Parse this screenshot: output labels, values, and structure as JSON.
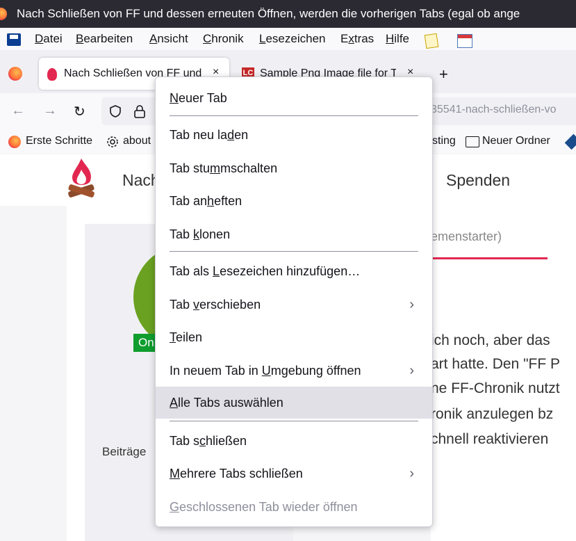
{
  "window": {
    "title": "Nach Schließen von FF und dessen erneuten Öffnen, werden die vorherigen Tabs (egal ob ange"
  },
  "menubar": {
    "items": [
      {
        "pre": "",
        "key": "D",
        "post": "atei"
      },
      {
        "pre": "",
        "key": "B",
        "post": "earbeiten"
      },
      {
        "pre": "",
        "key": "A",
        "post": "nsicht"
      },
      {
        "pre": "",
        "key": "C",
        "post": "hronik"
      },
      {
        "pre": "",
        "key": "L",
        "post": "esezeichen"
      },
      {
        "pre": "E",
        "key": "x",
        "post": "tras"
      },
      {
        "pre": "",
        "key": "H",
        "post": "ilfe"
      }
    ]
  },
  "tabs": [
    {
      "title": "Nach Schließen von FF und",
      "close": "×"
    },
    {
      "title": "Sample Png Image file for T",
      "close": "×",
      "icon_text": "LC"
    }
  ],
  "newtab": "+",
  "nav": {
    "back": "←",
    "forward": "→",
    "reload": "↻",
    "url_visible": "35541-nach-schließen-vo"
  },
  "bookmarks": [
    {
      "label": "Erste Schritte"
    },
    {
      "label": "about"
    },
    {
      "label": "sting"
    },
    {
      "label": "Neuer Ordner"
    }
  ],
  "site": {
    "nav_left": "Nach",
    "nav_right": "Spenden",
    "online_badge": "On",
    "beitraege": "Beiträge",
    "tab_label": "emenstarter)",
    "post_lines": [
      "ich noch, aber das",
      "art hatte. Den \"FF P",
      "ne FF-Chronik nutzt",
      "ronik anzulegen bz",
      "chnell reaktivieren"
    ]
  },
  "context_menu": {
    "items": [
      {
        "pre": "",
        "key": "N",
        "post": "euer Tab",
        "arrow": false,
        "highlight": false,
        "disabled": false
      },
      {
        "pre": "Tab neu la",
        "key": "d",
        "post": "en",
        "arrow": false,
        "highlight": false,
        "disabled": false
      },
      {
        "pre": "Tab stu",
        "key": "m",
        "post": "mschalten",
        "arrow": false,
        "highlight": false,
        "disabled": false
      },
      {
        "pre": "Tab an",
        "key": "h",
        "post": "eften",
        "arrow": false,
        "highlight": false,
        "disabled": false
      },
      {
        "pre": "Tab ",
        "key": "k",
        "post": "lonen",
        "arrow": false,
        "highlight": false,
        "disabled": false
      },
      {
        "pre": "Tab als ",
        "key": "L",
        "post": "esezeichen hinzufügen…",
        "arrow": false,
        "highlight": false,
        "disabled": false
      },
      {
        "pre": "Tab ",
        "key": "v",
        "post": "erschieben",
        "arrow": true,
        "highlight": false,
        "disabled": false
      },
      {
        "pre": "",
        "key": "T",
        "post": "eilen",
        "arrow": false,
        "highlight": false,
        "disabled": false
      },
      {
        "pre": "In neuem Tab in ",
        "key": "U",
        "post": "mgebung öffnen",
        "arrow": true,
        "highlight": false,
        "disabled": false
      },
      {
        "pre": "",
        "key": "A",
        "post": "lle Tabs auswählen",
        "arrow": false,
        "highlight": true,
        "disabled": false
      },
      {
        "pre": "Tab s",
        "key": "c",
        "post": "hließen",
        "arrow": false,
        "highlight": false,
        "disabled": false
      },
      {
        "pre": "",
        "key": "M",
        "post": "ehrere Tabs schließen",
        "arrow": true,
        "highlight": false,
        "disabled": false
      },
      {
        "pre": "",
        "key": "G",
        "post": "eschlossenen Tab wieder öffnen",
        "arrow": false,
        "highlight": false,
        "disabled": true
      }
    ],
    "arrow_glyph": "›"
  }
}
